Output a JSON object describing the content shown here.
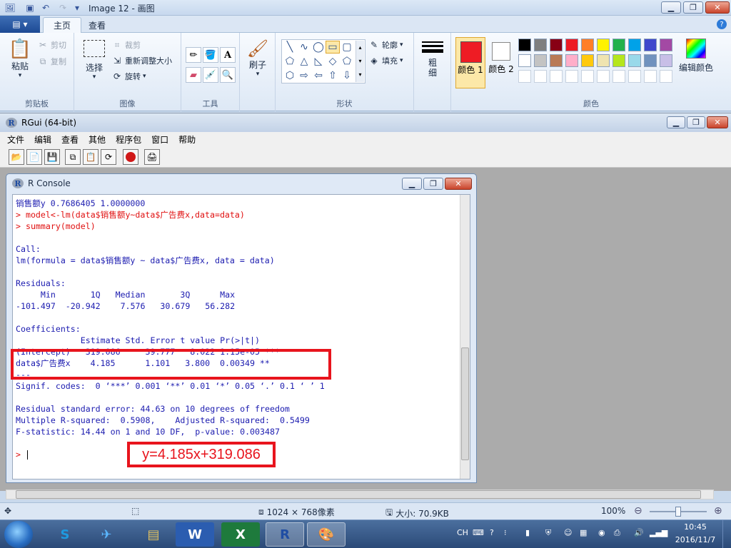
{
  "paint": {
    "title": "Image 12 - 画图",
    "tabs": [
      "主页",
      "查看"
    ],
    "clipboard": {
      "paste": "粘贴",
      "cut": "剪切",
      "copy": "复制",
      "label": "剪贴板"
    },
    "image": {
      "select": "选择",
      "crop": "裁剪",
      "resize": "重新调整大小",
      "rotate": "旋转",
      "label": "图像"
    },
    "tools": {
      "label": "工具"
    },
    "brushes": {
      "label": "刷子"
    },
    "shapes": {
      "outline": "轮廓",
      "fill": "填充",
      "label": "形状"
    },
    "size": {
      "label": "粗细"
    },
    "colors": {
      "color1": "颜色 1",
      "color2": "颜色 2",
      "edit": "编辑颜色",
      "label": "颜色",
      "color1_value": "#ee1c24",
      "color2_value": "#ffffff",
      "palette_row1": [
        "#000000",
        "#7f7f7f",
        "#880015",
        "#ed1c24",
        "#ff7f27",
        "#fff200",
        "#22b14c",
        "#00a2e8",
        "#3f48cc",
        "#a349a4"
      ],
      "palette_row2": [
        "#ffffff",
        "#c3c3c3",
        "#b97a57",
        "#ffaec9",
        "#ffc90e",
        "#efe4b0",
        "#b5e61d",
        "#99d9ea",
        "#7092be",
        "#c8bfe7"
      ]
    },
    "status": {
      "dimensions": "1024 × 768像素",
      "size": "大小: 70.9KB",
      "zoom": "100%"
    }
  },
  "rgui": {
    "title": "RGui (64-bit)",
    "menu": [
      "文件",
      "编辑",
      "查看",
      "其他",
      "程序包",
      "窗口",
      "帮助"
    ],
    "console_title": "R Console",
    "lines": [
      {
        "cls": "blue",
        "text": "销售额y 0.7686405 1.0000000"
      },
      {
        "cls": "red",
        "text": "> model<-lm(data$销售额y~data$广告费x,data=data)"
      },
      {
        "cls": "red",
        "text": "> summary(model)"
      },
      {
        "cls": "blue",
        "text": ""
      },
      {
        "cls": "blue",
        "text": "Call:"
      },
      {
        "cls": "blue",
        "text": "lm(formula = data$销售额y ~ data$广告费x, data = data)"
      },
      {
        "cls": "blue",
        "text": ""
      },
      {
        "cls": "blue",
        "text": "Residuals:"
      },
      {
        "cls": "blue",
        "text": "     Min       1Q   Median       3Q      Max "
      },
      {
        "cls": "blue",
        "text": "-101.497  -20.942    7.576   30.679   56.282 "
      },
      {
        "cls": "blue",
        "text": ""
      },
      {
        "cls": "blue",
        "text": "Coefficients:"
      },
      {
        "cls": "blue",
        "text": "             Estimate Std. Error t value Pr(>|t|)    "
      },
      {
        "cls": "blue",
        "text": "(Intercept)   319.086     39.777   8.022 1.15e-05 ***"
      },
      {
        "cls": "blue",
        "text": "data$广告费x    4.185      1.101   3.800  0.00349 ** "
      },
      {
        "cls": "blue",
        "text": "---"
      },
      {
        "cls": "blue",
        "text": "Signif. codes:  0 ‘***’ 0.001 ‘**’ 0.01 ‘*’ 0.05 ‘.’ 0.1 ‘ ’ 1"
      },
      {
        "cls": "blue",
        "text": ""
      },
      {
        "cls": "blue",
        "text": "Residual standard error: 44.63 on 10 degrees of freedom"
      },
      {
        "cls": "blue",
        "text": "Multiple R-squared:  0.5908,    Adjusted R-squared:  0.5499 "
      },
      {
        "cls": "blue",
        "text": "F-statistic: 14.44 on 1 and 10 DF,  p-value: 0.003487"
      },
      {
        "cls": "blue",
        "text": ""
      },
      {
        "cls": "red",
        "text": "> "
      }
    ],
    "annotation_equation": "y=4.185x+319.086"
  },
  "taskbar": {
    "ime": "CH",
    "time": "10:45",
    "date": "2016/11/7"
  }
}
